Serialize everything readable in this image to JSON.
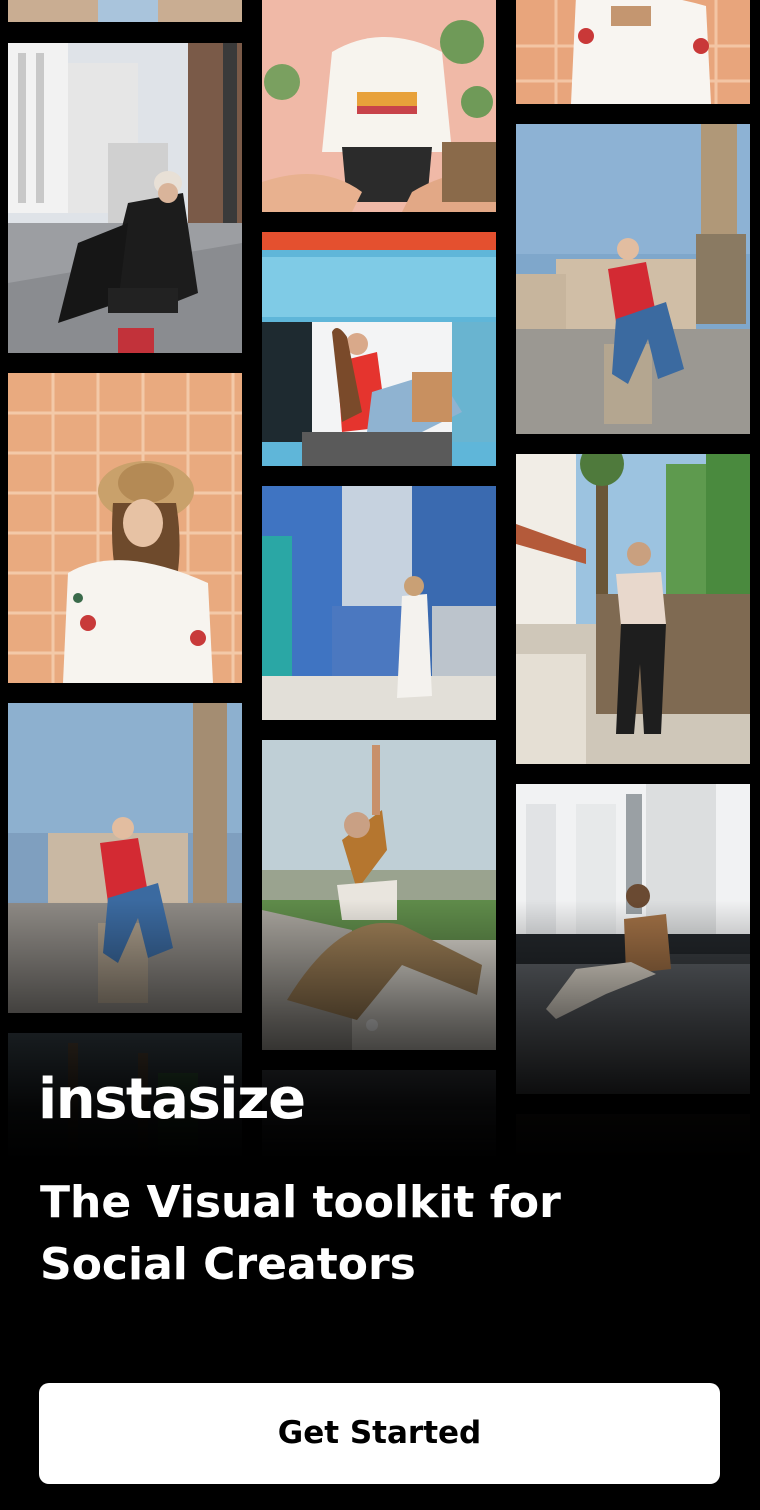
{
  "brand": {
    "logo_text": "instasize"
  },
  "hero": {
    "headline_line1": "The Visual toolkit for",
    "headline_line2": "Social Creators"
  },
  "actions": {
    "get_started_label": "Get Started"
  },
  "colors": {
    "background": "#000000",
    "button_background": "#ffffff",
    "button_text": "#000000",
    "text": "#ffffff"
  }
}
